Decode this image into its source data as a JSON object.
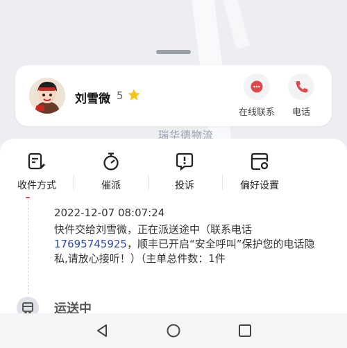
{
  "map": {
    "area_label": "瑞华德物流"
  },
  "courier": {
    "name": "刘雪微",
    "rating": "5",
    "actions": [
      {
        "label": "在线联系",
        "icon": "chat-dots-icon"
      },
      {
        "label": "电话",
        "icon": "phone-icon"
      }
    ]
  },
  "functions": [
    {
      "label": "收件方式",
      "icon": "edit-doc-icon"
    },
    {
      "label": "催派",
      "icon": "stopwatch-icon"
    },
    {
      "label": "投诉",
      "icon": "complaint-icon"
    },
    {
      "label": "偏好设置",
      "icon": "preference-icon"
    }
  ],
  "event": {
    "time": "2022-12-07 08:07:24",
    "text_before": "快件交给刘雪微，正在派送途中（联系电话",
    "phone": "17695745925",
    "text_after": "，顺丰已开启“安全呼叫”保护您的电话隐私,请放心接听！）（主单总件数：1件"
  },
  "status": {
    "label": "运送中"
  },
  "colors": {
    "accent_red": "#e2454a",
    "star_gold": "#f5c518",
    "link_blue": "#2647b7"
  }
}
